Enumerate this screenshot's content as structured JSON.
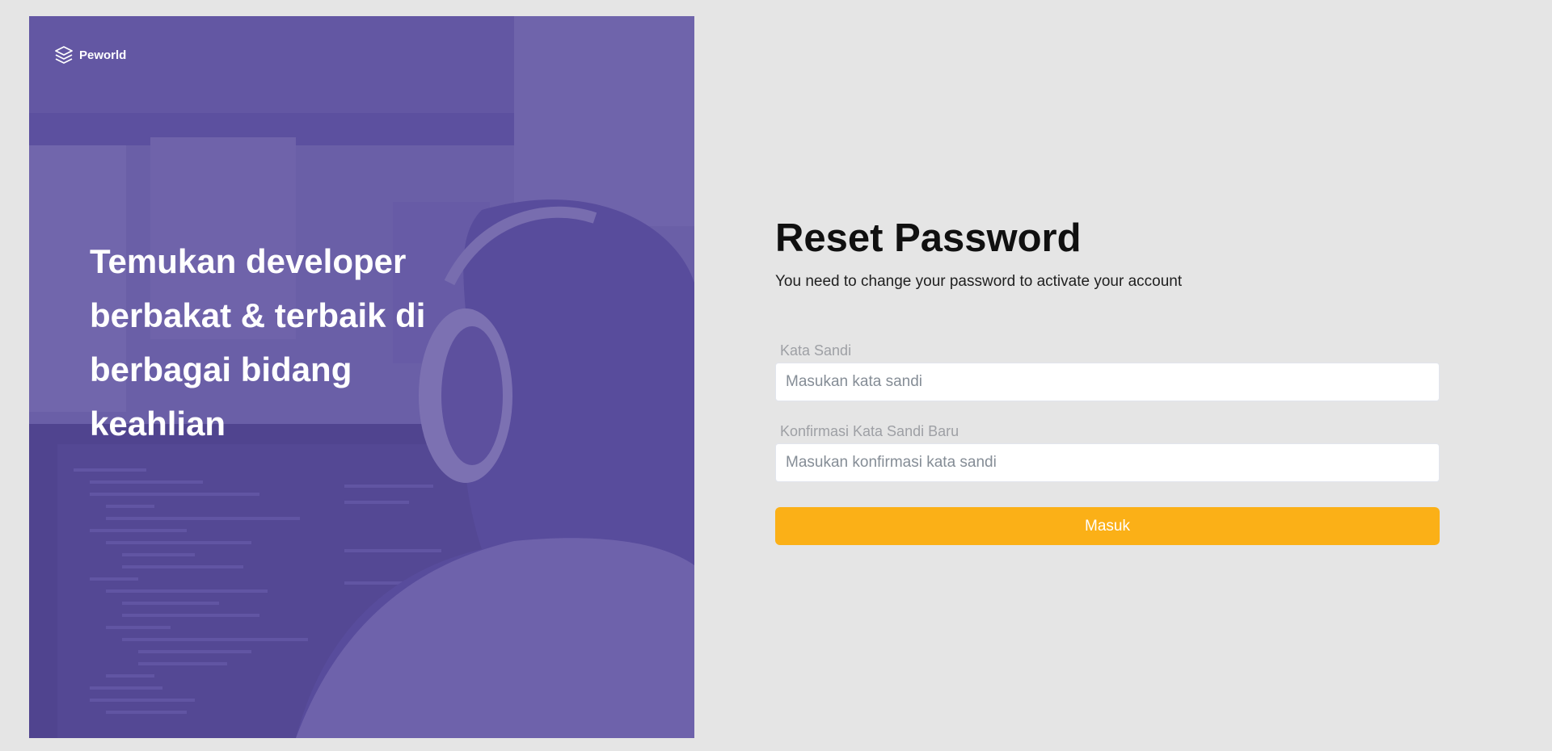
{
  "brand": {
    "name": "Peworld",
    "icon": "layers-icon"
  },
  "hero": {
    "headline": "Temukan developer berbakat & terbaik di berbagai bidang keahlian",
    "overlay_color": "#5e50a1"
  },
  "form": {
    "title": "Reset Password",
    "subtitle": "You need to change your password to activate your account",
    "fields": [
      {
        "label": "Kata Sandi",
        "placeholder": "Masukan kata sandi",
        "value": ""
      },
      {
        "label": "Konfirmasi Kata Sandi Baru",
        "placeholder": "Masukan konfirmasi kata sandi",
        "value": ""
      }
    ],
    "submit_label": "Masuk",
    "submit_color": "#fbb017"
  }
}
